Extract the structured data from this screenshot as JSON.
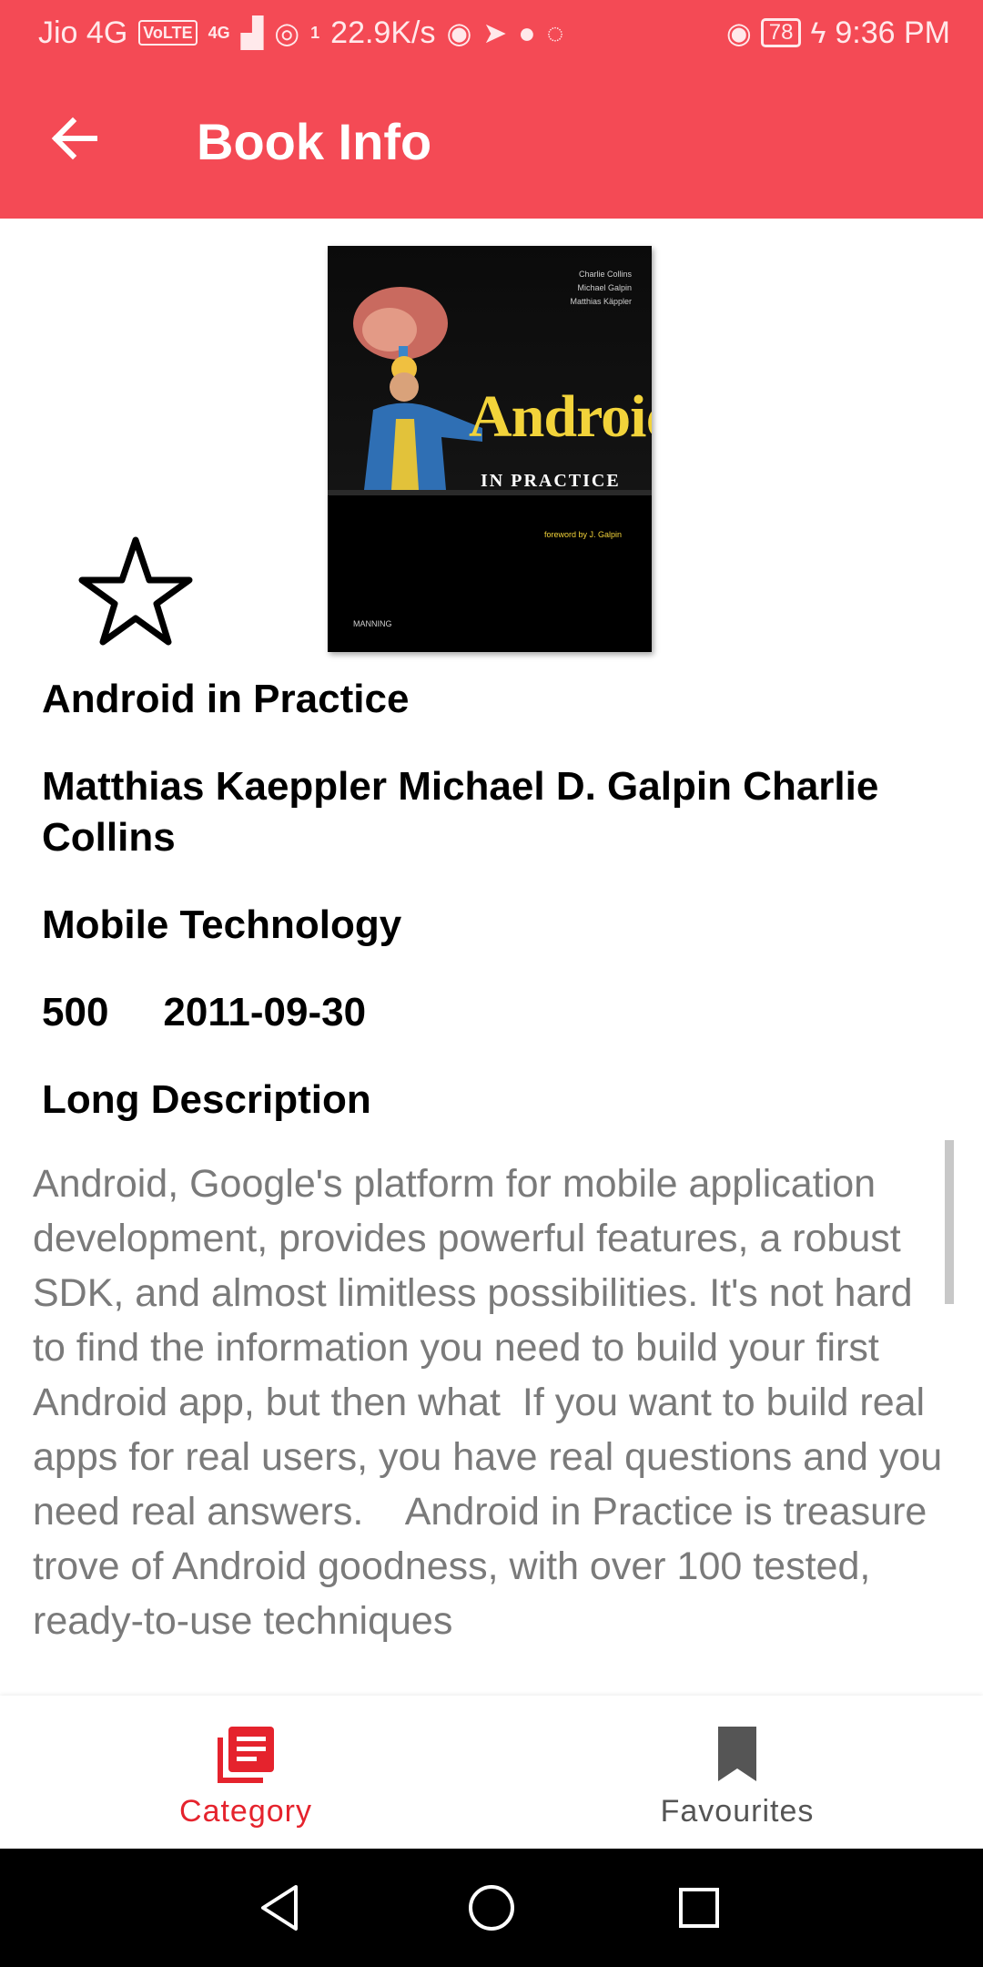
{
  "status_bar": {
    "carrier": "Jio 4G",
    "volte": "VoLTE",
    "network_small": "4G",
    "hotspot_sup": "1",
    "speed": "22.9K/s",
    "battery": "78",
    "time": "9:36 PM"
  },
  "app_bar": {
    "title": "Book Info",
    "back_icon": "arrow-left-icon"
  },
  "book": {
    "cover": {
      "title": "Android",
      "subtitle": "IN PRACTICE",
      "authors": [
        "Charlie Collins",
        "Michael Galpin",
        "Matthias Käppler"
      ],
      "foreword": "foreword by J. Galpin",
      "publisher": "MANNING"
    },
    "favorite_icon": "star-outline-icon",
    "title": "Android in Practice",
    "authors": "Matthias Kaeppler  Michael D. Galpin Charlie Collins",
    "category": "Mobile Technology",
    "pages": "500",
    "published_date": "2011-09-30",
    "description_heading": "Long Description",
    "description": "Android, Google's platform for mobile application development, provides powerful features, a robust SDK, and almost limitless possibilities. It's not hard to find the information you need to build your first Android app, but then what  If you want to build real apps for real users, you have real questions and you need real answers.    Android in Practice is treasure trove of Android goodness, with over 100 tested, ready-to-use techniques"
  },
  "bottom_nav": {
    "items": [
      {
        "label": "Category",
        "icon": "category-list-icon",
        "active": true
      },
      {
        "label": "Favourites",
        "icon": "bookmark-icon",
        "active": false
      }
    ]
  },
  "colors": {
    "primary": "#f44a55",
    "active_nav": "#e5232d",
    "description_text": "#7a7a7a"
  }
}
